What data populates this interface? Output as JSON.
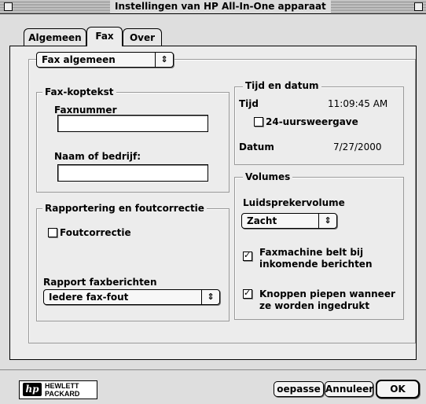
{
  "window": {
    "title": "Instellingen van HP All-In-One apparaat"
  },
  "tabs": [
    {
      "label": "Algemeen"
    },
    {
      "label": "Fax"
    },
    {
      "label": "Over"
    }
  ],
  "section_popup": {
    "value": "Fax algemeen"
  },
  "fax_header": {
    "group_label": "Fax-koptekst",
    "fax_number_label": "Faxnummer",
    "fax_number_value": "",
    "name_label": "Naam of bedrijf:",
    "name_value": ""
  },
  "reporting": {
    "group_label": "Rapportering en foutcorrectie",
    "error_correction_label": "Foutcorrectie",
    "error_correction_checked": false,
    "report_label": "Rapport faxberichten",
    "report_value": "Iedere fax-fout"
  },
  "time_date": {
    "group_label": "Tijd en datum",
    "time_label": "Tijd",
    "time_value": "11:09:45 AM",
    "hour24_label": "24-uursweergave",
    "hour24_checked": false,
    "date_label": "Datum",
    "date_value": "7/27/2000"
  },
  "volumes": {
    "group_label": "Volumes",
    "speaker_label": "Luidsprekervolume",
    "speaker_value": "Zacht",
    "ring_line1": "Faxmachine belt bij",
    "ring_line2": "inkomende berichten",
    "ring_checked": true,
    "beep_line1": "Knoppen piepen wanneer",
    "beep_line2": "ze worden ingedrukt",
    "beep_checked": true
  },
  "logo": {
    "line1": "HEWLETT",
    "line2": "PACKARD",
    "mark": "hp"
  },
  "buttons": {
    "apply": "oepasse",
    "cancel": "Annuleer",
    "ok": "OK"
  }
}
